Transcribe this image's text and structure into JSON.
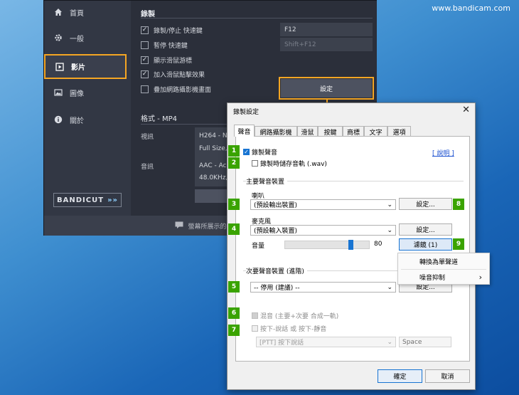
{
  "watermark": "www.bandicam.com",
  "sidebar": {
    "items": [
      {
        "label": "首頁",
        "icon": "home-icon"
      },
      {
        "label": "一般",
        "icon": "gear-icon"
      },
      {
        "label": "影片",
        "icon": "video-icon"
      },
      {
        "label": "圖像",
        "icon": "image-icon"
      },
      {
        "label": "關於",
        "icon": "info-icon"
      }
    ],
    "bandicut": "BANDICUT"
  },
  "record": {
    "title": "錄製",
    "items": [
      {
        "label": "錄製/停止 快速鍵",
        "checked": true,
        "value": "F12"
      },
      {
        "label": "暫停 快速鍵",
        "checked": false,
        "value": "Shift+F12"
      },
      {
        "label": "顯示滑鼠游標",
        "checked": true
      },
      {
        "label": "加入滑鼠點擊效果",
        "checked": true
      },
      {
        "label": "疊加網路攝影機畫面",
        "checked": false
      }
    ],
    "settings_button": "設定"
  },
  "format": {
    "title": "格式 - MP4",
    "video_label": "視訊",
    "video_line1": "H264 - N",
    "video_line2": "Full Size,",
    "audio_label": "音訊",
    "audio_line1": "AAC - Ac",
    "audio_line2": "48.0KHz,"
  },
  "status_text": "螢幕所展示的任何內",
  "dialog": {
    "title": "錄製設定",
    "close": "✕",
    "tabs": [
      "聲音",
      "網路攝影機",
      "滑鼠",
      "按鍵",
      "商標",
      "文字",
      "選項"
    ],
    "record_sound": "錄製聲音",
    "help": "[ 說明 ]",
    "save_wav": "錄製時儲存音軌 (.wav)",
    "primary_group": "主要聲音裝置",
    "speaker_label": "喇叭",
    "speaker_value": "(預設輸出裝置)",
    "mic_label": "麥克風",
    "mic_value": "(預設輸入裝置)",
    "volume_label": "音量",
    "volume_value": "80",
    "settings_btn": "設定...",
    "filter_btn": "濾鏡 (1)",
    "secondary_group": "次要聲音裝置 (進階)",
    "secondary_value": "-- 停用 (建議) --",
    "mix": "混音 (主要+次要 合成一軌)",
    "ptt": "按下-說話 或 按下-靜音",
    "ptt_value": "[PTT] 按下說話",
    "ptt_key": "Space",
    "ok": "確定",
    "cancel": "取消"
  },
  "menu": {
    "items": [
      "轉換為單聲道",
      "噪音抑制"
    ]
  },
  "badges": [
    "1",
    "2",
    "3",
    "4",
    "5",
    "6",
    "7",
    "8",
    "9"
  ],
  "colors": {
    "accent": "#f5a623",
    "badge": "#3aa300",
    "checkbox": "#1874d2"
  }
}
